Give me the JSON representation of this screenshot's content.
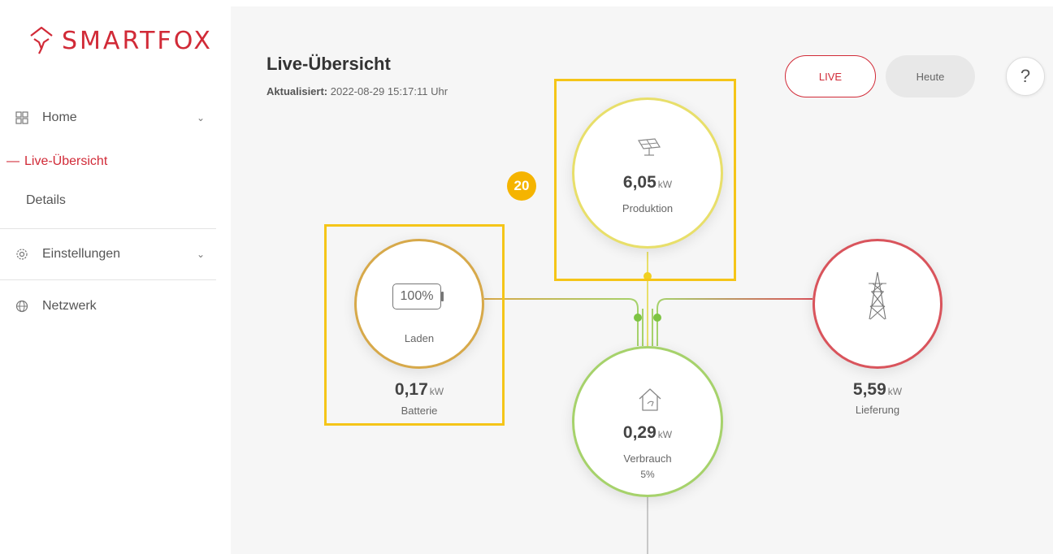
{
  "brand": {
    "name": "SMARTFOX",
    "color": "#d12a37"
  },
  "sidebar": {
    "items": [
      {
        "label": "Home",
        "icon": "grid-icon"
      },
      {
        "label": "Live-Übersicht"
      },
      {
        "label": "Details"
      },
      {
        "label": "Einstellungen",
        "icon": "gear-icon"
      },
      {
        "label": "Netzwerk",
        "icon": "globe-icon"
      }
    ]
  },
  "header": {
    "title": "Live-Übersicht",
    "updated_label": "Aktualisiert:",
    "updated_value": "2022-08-29 15:17:11 Uhr",
    "live_label": "LIVE",
    "today_label": "Heute",
    "help_label": "?"
  },
  "nodes": {
    "production": {
      "value": "6,05",
      "unit": "kW",
      "label": "Produktion",
      "icon": "solar-panel-icon",
      "color": "#e8df6a"
    },
    "battery": {
      "icon_text": "100%",
      "state": "Laden",
      "value": "0,17",
      "unit": "kW",
      "label": "Batterie",
      "icon": "battery-icon",
      "color": "#d7a94a"
    },
    "grid": {
      "value": "5,59",
      "unit": "kW",
      "label": "Lieferung",
      "icon": "power-tower-icon",
      "color": "#d9545c"
    },
    "consumption": {
      "value": "0,29",
      "unit": "kW",
      "label": "Verbrauch",
      "percent": "5%",
      "icon": "house-icon",
      "color": "#a6d26b"
    }
  },
  "annotation": {
    "badge": "20",
    "color": "#f5c518"
  }
}
